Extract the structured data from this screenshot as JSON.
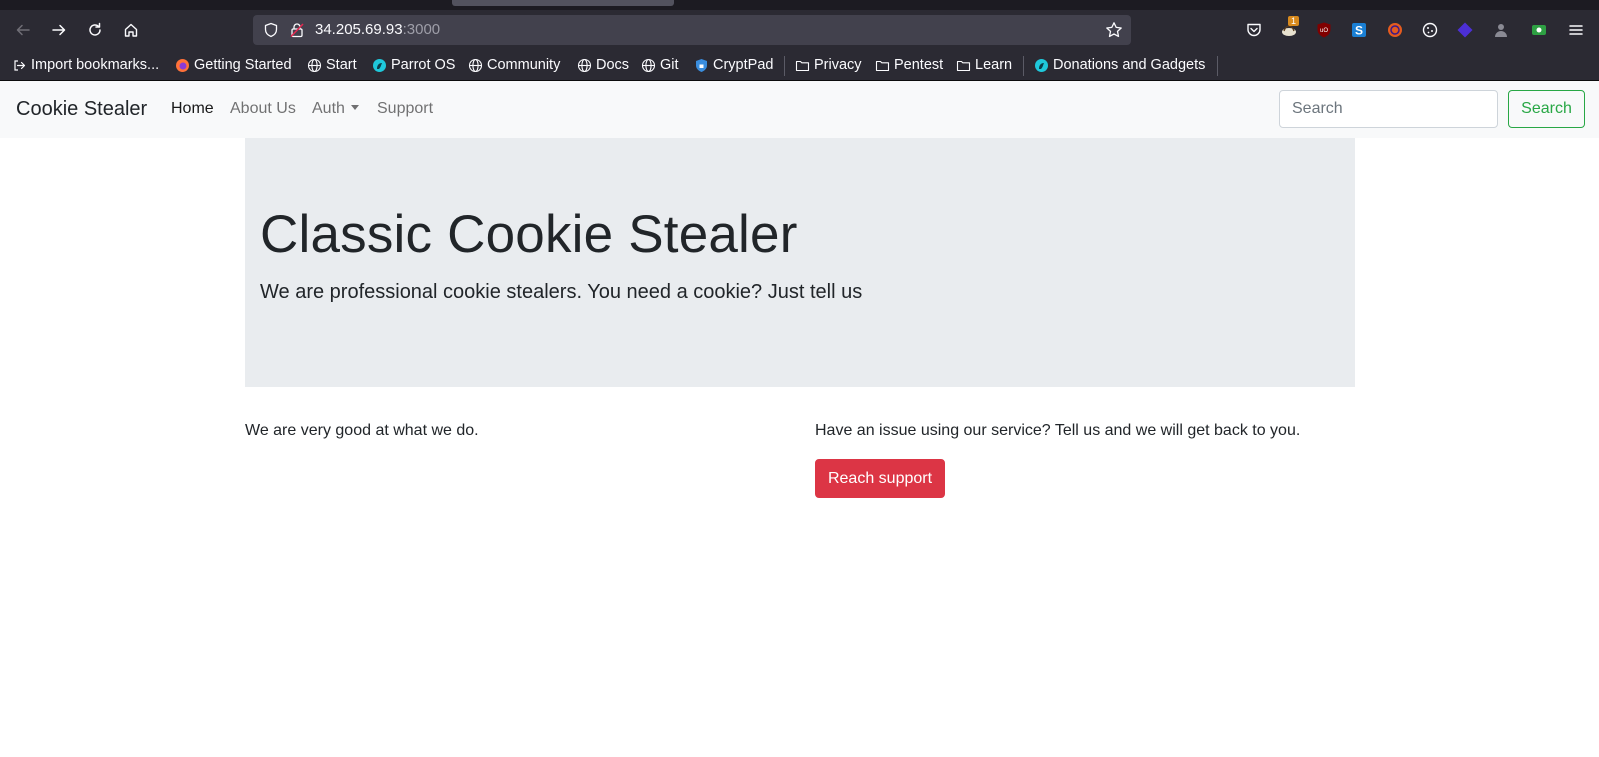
{
  "browser": {
    "url_host": "34.205.69.93",
    "url_port": ":3000",
    "bookmarks": [
      {
        "label": "Import bookmarks...",
        "icon": "import-icon"
      },
      {
        "label": "Getting Started",
        "icon": "firefox-icon"
      },
      {
        "label": "Start",
        "icon": "globe-icon"
      },
      {
        "label": "Parrot OS",
        "icon": "parrot-icon"
      },
      {
        "label": "Community",
        "icon": "globe-icon"
      },
      {
        "label": "Docs",
        "icon": "globe-icon"
      },
      {
        "label": "Git",
        "icon": "globe-icon"
      },
      {
        "label": "CryptPad",
        "icon": "cryptpad-icon"
      },
      {
        "label": "Privacy",
        "icon": "folder-icon"
      },
      {
        "label": "Pentest",
        "icon": "folder-icon"
      },
      {
        "label": "Learn",
        "icon": "folder-icon"
      },
      {
        "label": "Donations and Gadgets",
        "icon": "parrot-icon"
      }
    ],
    "extension_badge": "1"
  },
  "navbar": {
    "brand": "Cookie Stealer",
    "links": {
      "home": "Home",
      "about": "About Us",
      "auth": "Auth",
      "support": "Support"
    },
    "search_placeholder": "Search",
    "search_button": "Search"
  },
  "hero": {
    "title": "Classic Cookie Stealer",
    "lead": "We are professional cookie stealers. You need a cookie? Just tell us"
  },
  "content": {
    "left_text": "We are very good at what we do.",
    "right_text": "Have an issue using our service? Tell us and we will get back to you.",
    "support_button": "Reach support"
  },
  "colors": {
    "chrome_bg": "#2b2a33",
    "urlbar_bg": "#42414d",
    "navbar_bg": "#f8f9fa",
    "jumbotron_bg": "#e9ecef",
    "success": "#28a745",
    "danger": "#dc3545"
  }
}
